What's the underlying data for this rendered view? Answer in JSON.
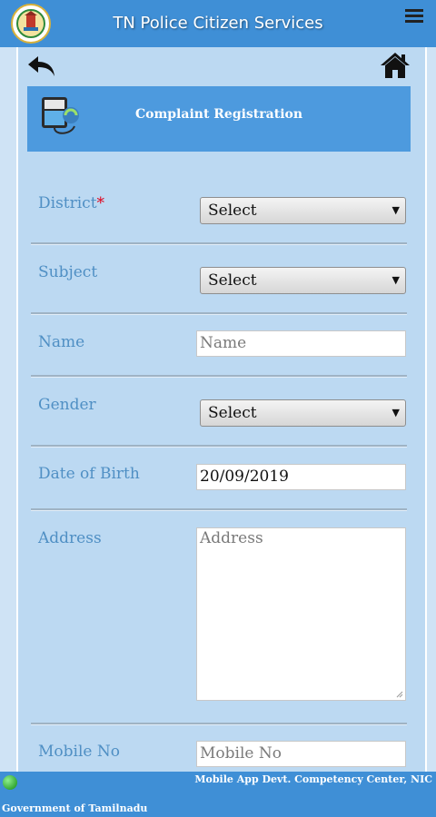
{
  "app": {
    "title": "TN Police Citizen Services",
    "emblem_icon": "tn-government-emblem-icon",
    "menu_icon": "hamburger-menu-icon"
  },
  "nav": {
    "back_icon": "back-arrow-icon",
    "home_icon": "home-icon"
  },
  "banner": {
    "title": "Complaint Registration",
    "icon": "complaint-registration-icon"
  },
  "form": {
    "district": {
      "label": "District",
      "required_mark": "*",
      "value": "Select"
    },
    "subject": {
      "label": "Subject",
      "value": "Select"
    },
    "name": {
      "label": "Name",
      "placeholder": "Name"
    },
    "gender": {
      "label": "Gender",
      "value": "Select"
    },
    "dob": {
      "label": "Date of Birth",
      "value": "20/09/2019"
    },
    "address": {
      "label": "Address",
      "placeholder": "Address"
    },
    "mobile": {
      "label": "Mobile No",
      "placeholder": "Mobile No"
    }
  },
  "footer": {
    "credit": "Mobile App Devt. Competency Center, NIC",
    "org": "Government of Tamilnadu"
  },
  "colors": {
    "header": "#3f8fd6",
    "page_bg": "#bcd9f2",
    "banner": "#4d9ade",
    "label": "#4f8fc4",
    "required": "#e0001a"
  }
}
